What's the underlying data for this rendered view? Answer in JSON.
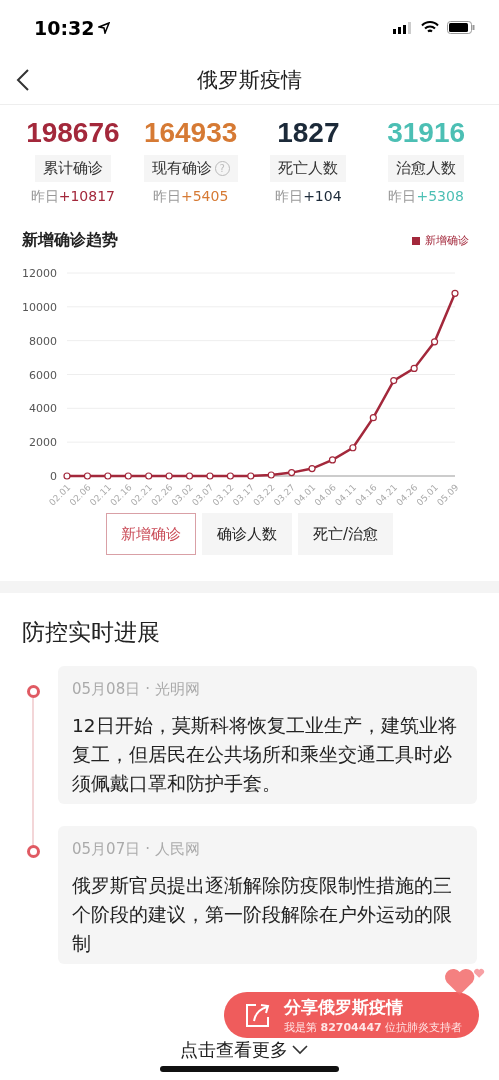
{
  "status_bar": {
    "time": "10:32"
  },
  "nav": {
    "title": "俄罗斯疫情"
  },
  "stats": [
    {
      "value": "198676",
      "label": "累计确诊",
      "yesterday_prefix": "昨日",
      "yesterday": "+10817",
      "color": "#a3283b"
    },
    {
      "value": "164933",
      "label": "现有确诊",
      "help": "?",
      "yesterday_prefix": "昨日",
      "yesterday": "+5405",
      "color": "#d67a34"
    },
    {
      "value": "1827",
      "label": "死亡人数",
      "yesterday_prefix": "昨日",
      "yesterday": "+104",
      "color": "#1c2a39"
    },
    {
      "value": "31916",
      "label": "治愈人数",
      "yesterday_prefix": "昨日",
      "yesterday": "+5308",
      "color": "#4cbfb4"
    }
  ],
  "trend": {
    "title": "新增确诊趋势",
    "chart_data": {
      "type": "line",
      "grid": true,
      "categories": [
        "02.01",
        "02.06",
        "02.11",
        "02.16",
        "02.21",
        "02.26",
        "03.02",
        "03.07",
        "03.12",
        "03.17",
        "03.22",
        "03.27",
        "04.01",
        "04.06",
        "04.11",
        "04.16",
        "04.21",
        "04.26",
        "05.01",
        "05.09"
      ],
      "series": [
        {
          "name": "新增确诊",
          "color": "#a3283b",
          "marker": true,
          "values": [
            0,
            0,
            0,
            0,
            0,
            0,
            0,
            0,
            0,
            0,
            60,
            200,
            440,
            950,
            1670,
            3450,
            5640,
            6360,
            7930,
            10800
          ]
        }
      ],
      "ylim": [
        0,
        12000
      ],
      "yticks": [
        0,
        2000,
        4000,
        6000,
        8000,
        10000,
        12000
      ]
    }
  },
  "chart_tabs": [
    {
      "label": "新增确诊",
      "selected": true
    },
    {
      "label": "确诊人数",
      "selected": false
    },
    {
      "label": "死亡/治愈",
      "selected": false
    }
  ],
  "progress": {
    "title": "防控实时进展",
    "items": [
      {
        "date": "05月08日",
        "separator": "·",
        "source": "光明网",
        "text": "12日开始，莫斯科将恢复工业生产，建筑业将复工，但居民在公共场所和乘坐交通工具时必须佩戴口罩和防护手套。"
      },
      {
        "date": "05月07日",
        "separator": "·",
        "source": "人民网",
        "text": "俄罗斯官员提出逐渐解除防疫限制性措施的三个阶段的建议，第一阶段解除在户外运动的限制"
      }
    ],
    "more": "点击查看更多"
  },
  "share": {
    "title": "分享俄罗斯疫情",
    "subtitle": "我是第 **82704447** 位抗肺炎支持者"
  }
}
